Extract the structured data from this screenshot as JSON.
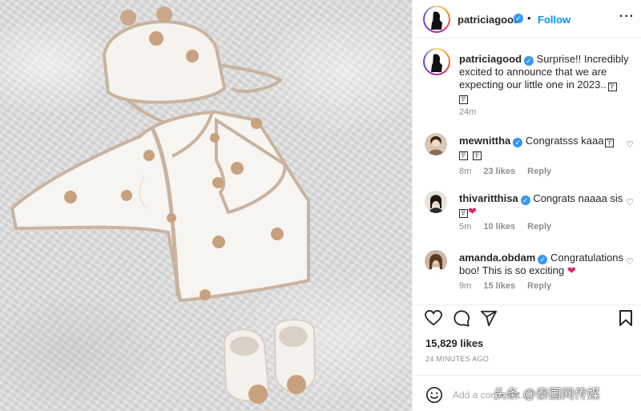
{
  "post": {
    "author": "patriciagood",
    "follow_label": "Follow",
    "separator": "•",
    "more_icon": "more-horizontal-icon"
  },
  "caption": {
    "username": "patriciagood",
    "line1": "Surprise!! Incredibly",
    "line2": "excited to announce that we are",
    "line3": "expecting our little one in 2023..",
    "time": "24m"
  },
  "comments": [
    {
      "username": "mewnittha",
      "text": "Congratsss kaaa",
      "time": "8m",
      "likes": "23 likes",
      "reply": "Reply"
    },
    {
      "username": "thivaritthisa",
      "text": "Congrats naaaa sis",
      "time": "5m",
      "likes": "10 likes",
      "reply": "Reply"
    },
    {
      "username": "amanda.obdam",
      "text1": "Congratulations",
      "text2": "boo! This is so exciting",
      "time": "9m",
      "likes": "15 likes",
      "reply": "Reply"
    }
  ],
  "stats": {
    "likes": "15,829 likes",
    "time_ago": "24 MINUTES AGO"
  },
  "add_comment": {
    "placeholder": "Add a comment..."
  },
  "watermark": "头条 @泰国网传媒",
  "icons": [
    "heart-icon",
    "comment-icon",
    "share-icon",
    "bookmark-icon",
    "smiley-icon",
    "verified-icon"
  ],
  "colors": {
    "accent": "#0095f6",
    "verified": "#3897f0",
    "heart": "#e0245e",
    "muted": "#8e8e8e"
  }
}
